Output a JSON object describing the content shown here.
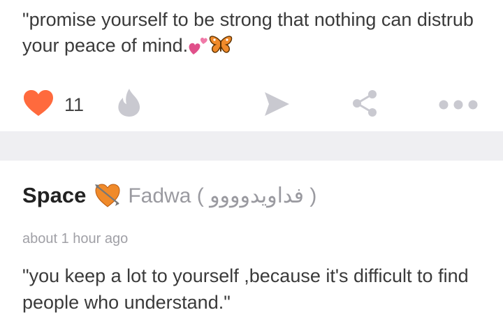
{
  "post": {
    "text": "\"promise yourself  to be strong that nothing can distrub your  peace of mind.",
    "emojis": [
      "two-hearts-icon",
      "butterfly-icon"
    ]
  },
  "actions": {
    "like_count": "11",
    "icons": [
      "heart-icon",
      "flame-icon",
      "send-icon",
      "share-icon",
      "more-icon"
    ],
    "colors": {
      "heart": "#ff6a3d",
      "inactive": "#c9c9d0"
    }
  },
  "comment": {
    "blog_name": "Space",
    "blog_icon": "heart-with-arrow-icon",
    "author_name": "Fadwa ( فداويدوووو )",
    "timestamp": "about 1 hour ago",
    "text": "\"you keep a lot to yourself ,because it's difficult to find people who understand.\""
  }
}
